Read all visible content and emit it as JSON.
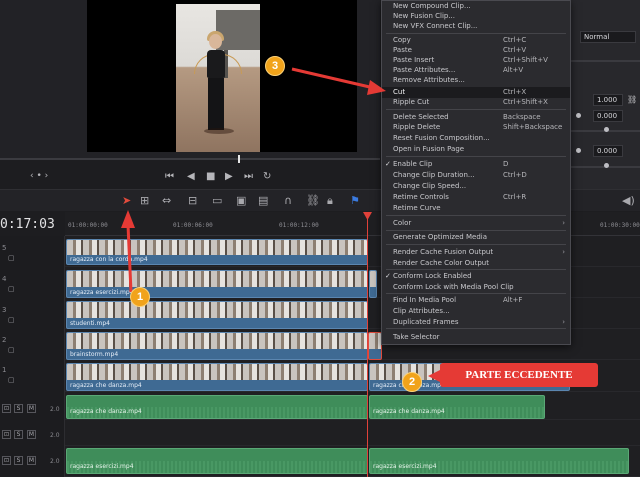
{
  "timecode": "0:17:03",
  "ruler_ticks": [
    "01:00:00:00",
    "01:00:06:00",
    "01:00:12:00",
    "01:00:30:00"
  ],
  "inspector": {
    "blend_mode": "Normal",
    "values": [
      "1.000",
      "0.000",
      "0.000"
    ]
  },
  "tracks": {
    "video_numbers": [
      "5",
      "4",
      "3",
      "2",
      "1"
    ],
    "audio_level": "2.0",
    "audio_buttons": [
      "S",
      "M"
    ]
  },
  "clips": {
    "v5": "ragazza con la corda.mp4",
    "v4": "ragazza esercizi.mp4",
    "v3": "studenti.mp4",
    "v2": "brainstorm.mp4",
    "v1a": "ragazza che danza.mp4",
    "v1b": "ragazza che danza.mp4",
    "a1a": "ragazza che danza.mp4",
    "a1b": "ragazza che danza.mp4",
    "a3a": "ragazza esercizi.mp4",
    "a3b": "ragazza esercizi.mp4"
  },
  "menu": {
    "items": [
      {
        "label": "New Compound Clip...",
        "shortcut": ""
      },
      {
        "label": "New Fusion Clip...",
        "shortcut": ""
      },
      {
        "label": "New VFX Connect Clip...",
        "shortcut": ""
      },
      {
        "label": "Copy",
        "shortcut": "Ctrl+C"
      },
      {
        "label": "Paste",
        "shortcut": "Ctrl+V"
      },
      {
        "label": "Paste Insert",
        "shortcut": "Ctrl+Shift+V"
      },
      {
        "label": "Paste Attributes...",
        "shortcut": "Alt+V"
      },
      {
        "label": "Remove Attributes...",
        "shortcut": ""
      },
      {
        "label": "Cut",
        "shortcut": "Ctrl+X"
      },
      {
        "label": "Ripple Cut",
        "shortcut": "Ctrl+Shift+X"
      },
      {
        "label": "Delete Selected",
        "shortcut": "Backspace"
      },
      {
        "label": "Ripple Delete",
        "shortcut": "Shift+Backspace"
      },
      {
        "label": "Reset Fusion Composition...",
        "shortcut": ""
      },
      {
        "label": "Open in Fusion Page",
        "shortcut": ""
      },
      {
        "label": "Enable Clip",
        "shortcut": "D"
      },
      {
        "label": "Change Clip Duration...",
        "shortcut": "Ctrl+D"
      },
      {
        "label": "Change Clip Speed...",
        "shortcut": ""
      },
      {
        "label": "Retime Controls",
        "shortcut": "Ctrl+R"
      },
      {
        "label": "Retime Curve",
        "shortcut": ""
      },
      {
        "label": "Color",
        "shortcut": ""
      },
      {
        "label": "Generate Optimized Media",
        "shortcut": ""
      },
      {
        "label": "Render Cache Fusion Output",
        "shortcut": ""
      },
      {
        "label": "Render Cache Color Output",
        "shortcut": ""
      },
      {
        "label": "Conform Lock Enabled",
        "shortcut": ""
      },
      {
        "label": "Conform Lock with Media Pool Clip",
        "shortcut": ""
      },
      {
        "label": "Find In Media Pool",
        "shortcut": "Alt+F"
      },
      {
        "label": "Clip Attributes...",
        "shortcut": ""
      },
      {
        "label": "Duplicated Frames",
        "shortcut": ""
      },
      {
        "label": "Take Selector",
        "shortcut": ""
      }
    ]
  },
  "annotations": {
    "badge1": "1",
    "badge2": "2",
    "badge3": "3",
    "callout": "PARTE ECCEDENTE"
  },
  "colors": {
    "accent_red": "#e53a35",
    "badge_orange": "#f1a31b",
    "video_clip": "#3f6a93",
    "audio_clip": "#3f8d5a"
  }
}
